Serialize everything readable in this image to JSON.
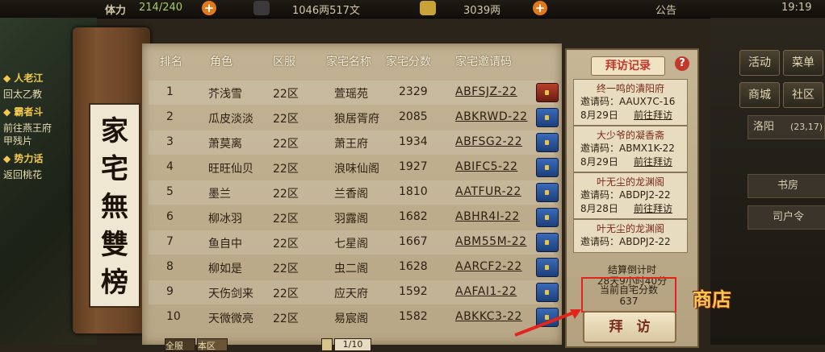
{
  "topbar": {
    "stamina_label": "体力",
    "stamina_value": "214/240",
    "money": "1046两517文",
    "gold": "3039两",
    "notice": "公告",
    "clock": "19:19"
  },
  "left_quests": [
    {
      "text": "人老江",
      "highlight": true
    },
    {
      "text": "回太乙教",
      "highlight": false
    },
    {
      "text": "霸者斗",
      "highlight": true
    },
    {
      "text": "前往燕王府",
      "highlight": false
    },
    {
      "text": "甲残片",
      "highlight": false
    },
    {
      "text": "势力话",
      "highlight": true
    },
    {
      "text": "返回桃花",
      "highlight": false
    }
  ],
  "title": "家宅無雙榜",
  "table": {
    "headers": [
      "排名",
      "角色",
      "区服",
      "家宅名称",
      "家宅分数",
      "家宅邀请码"
    ],
    "rows": [
      {
        "rank": "1",
        "role": "芥浅雪",
        "server": "22区",
        "house": "萱瑶苑",
        "score": "2329",
        "code": "ABFSJZ-22",
        "chest": "red"
      },
      {
        "rank": "2",
        "role": "瓜皮淡淡",
        "server": "22区",
        "house": "狼居胥府",
        "score": "2085",
        "code": "ABKRWD-22",
        "chest": "blue"
      },
      {
        "rank": "3",
        "role": "萧莫离",
        "server": "22区",
        "house": "萧王府",
        "score": "1934",
        "code": "ABFSG2-22",
        "chest": "blue"
      },
      {
        "rank": "4",
        "role": "旺旺仙贝",
        "server": "22区",
        "house": "浪味仙阁",
        "score": "1927",
        "code": "ABIFC5-22",
        "chest": "blue"
      },
      {
        "rank": "5",
        "role": "墨兰",
        "server": "22区",
        "house": "兰香阁",
        "score": "1810",
        "code": "AATFUR-22",
        "chest": "blue"
      },
      {
        "rank": "6",
        "role": "柳冰羽",
        "server": "22区",
        "house": "羽露阁",
        "score": "1682",
        "code": "ABHR4I-22",
        "chest": "blue"
      },
      {
        "rank": "7",
        "role": "鱼自中",
        "server": "22区",
        "house": "七星阁",
        "score": "1667",
        "code": "ABM55M-22",
        "chest": "blue"
      },
      {
        "rank": "8",
        "role": "柳如是",
        "server": "22区",
        "house": "虫二阁",
        "score": "1628",
        "code": "AARCF2-22",
        "chest": "blue"
      },
      {
        "rank": "9",
        "role": "天伤剑来",
        "server": "22区",
        "house": "应天府",
        "score": "1592",
        "code": "AAFAI1-22",
        "chest": "blue"
      },
      {
        "rank": "10",
        "role": "天微微亮",
        "server": "22区",
        "house": "易宸阁",
        "score": "1582",
        "code": "ABKKC3-22",
        "chest": "blue"
      }
    ]
  },
  "bottom": {
    "tab_all": "全服",
    "tab_self": "本区",
    "page": "1/10"
  },
  "visit_panel": {
    "title": "拜访记录",
    "help": "?",
    "records": [
      {
        "name": "终一鸣的潰阳府",
        "code": "邀请码：AAUX7C-16",
        "date": "8月29日",
        "action": "前往拜访"
      },
      {
        "name": "大少爷的凝香斋",
        "code": "邀请码：ABMX1K-22",
        "date": "8月29日",
        "action": "前往拜访"
      },
      {
        "name": "叶无尘的龙渊阁",
        "code": "邀请码：ABDPJ2-22",
        "date": "8月28日",
        "action": "前往拜访"
      },
      {
        "name": "叶无尘的龙渊阁",
        "code": "邀请码：ABDPJ2-22",
        "date": "",
        "action": ""
      }
    ],
    "countdown_label": "结算倒计时",
    "countdown": "28天9小时40分",
    "score_label": "当前自宅分数",
    "score_value": "637",
    "visit_button": "拜　访"
  },
  "right_menu": {
    "btn_activity": "活动",
    "btn_menu": "菜单",
    "btn_shop": "商城",
    "btn_community": "社区",
    "location": "洛阳",
    "coords": "(23,17)",
    "btn_study": "书房",
    "btn_command": "司户令"
  },
  "shop_label": "商店",
  "colors": {
    "highlight_box": "#e3241d",
    "header_text": "#f4ecd8",
    "chest_blue": "#2a5aa8",
    "chest_red": "#b8402a"
  }
}
